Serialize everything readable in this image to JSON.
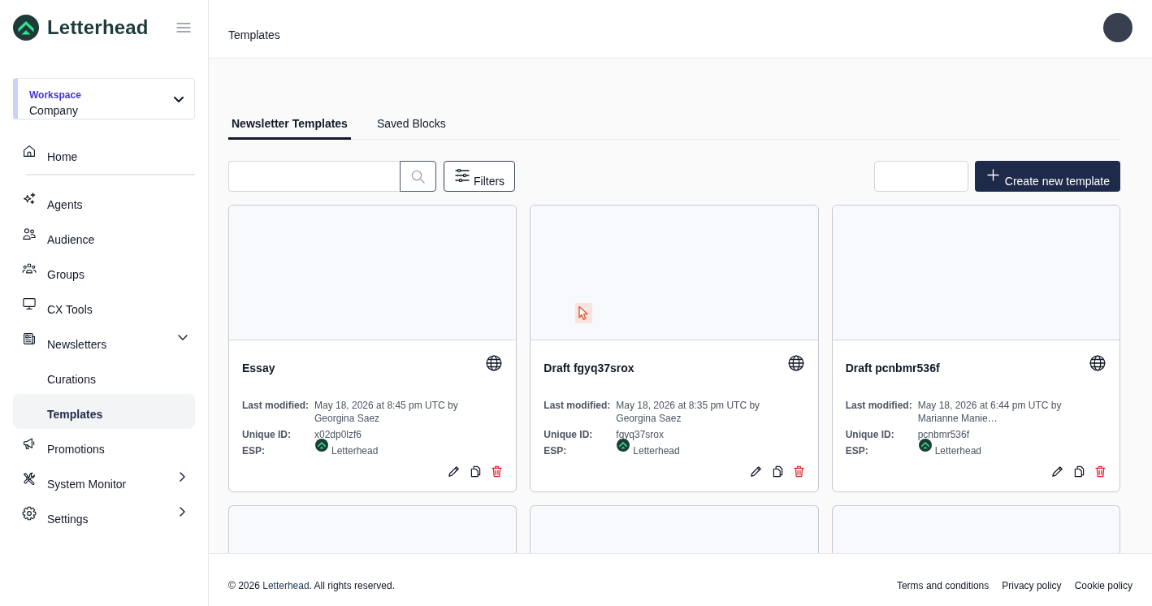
{
  "brand": {
    "name": "Letterhead"
  },
  "workspace": {
    "label": "Workspace",
    "value": "Company"
  },
  "nav": {
    "groups": [
      {
        "items": [
          {
            "label": "Home",
            "selected": false
          }
        ]
      },
      {
        "items": [
          {
            "label": "Agents",
            "selected": false
          },
          {
            "label": "Audience",
            "selected": false
          },
          {
            "label": "Groups",
            "selected": false
          },
          {
            "label": "CX Tools",
            "selected": false
          },
          {
            "label": "Newsletters",
            "selected": false,
            "expanded": true,
            "children": [
              {
                "label": "Curations",
                "selected": false
              },
              {
                "label": "Templates",
                "selected": true
              }
            ]
          },
          {
            "label": "Promotions",
            "selected": false
          },
          {
            "label": "System Monitor",
            "selected": false,
            "expanded": false
          },
          {
            "label": "Settings",
            "selected": false,
            "expanded": false
          }
        ]
      }
    ]
  },
  "header": {
    "title": "Templates"
  },
  "tabs": [
    {
      "label": "Newsletter Templates",
      "selected": true
    },
    {
      "label": "Saved Blocks",
      "selected": false
    }
  ],
  "toolbar": {
    "filters": "Filters",
    "create": "Create new template"
  },
  "cards": [
    {
      "title": "Essay",
      "public": true,
      "thumbnail": false,
      "fields": [
        {
          "kind": "text",
          "label": "Last modified:",
          "value": "May 18, 2026 at 8:45 pm UTC by Georgina Saez"
        },
        {
          "kind": "text",
          "label": "Unique ID:",
          "value": "x02dp0lzf6"
        },
        {
          "kind": "esp",
          "label": "ESP:",
          "value": "Letterhead"
        }
      ]
    },
    {
      "title": "Draft fgyq37srox",
      "public": true,
      "thumbnail": true,
      "fields": [
        {
          "kind": "text",
          "label": "Last modified:",
          "value": "May 18, 2026 at 8:35 pm UTC by Georgina Saez"
        },
        {
          "kind": "text",
          "label": "Unique ID:",
          "value": "fgyq37srox"
        },
        {
          "kind": "esp",
          "label": "ESP:",
          "value": "Letterhead"
        }
      ]
    },
    {
      "title": "Draft pcnbmr536f",
      "public": true,
      "thumbnail": false,
      "fields": [
        {
          "kind": "text",
          "label": "Last modified:",
          "value": "May 18, 2026 at 6:44 pm UTC by Marianne Manie…"
        },
        {
          "kind": "text",
          "label": "Unique ID:",
          "value": "pcnbmr536f"
        },
        {
          "kind": "esp",
          "label": "ESP:",
          "value": "Letterhead"
        }
      ]
    }
  ],
  "partial_cards": [
    {
      "thumbnail": false
    },
    {
      "thumbnail": false
    },
    {
      "thumbnail": false
    }
  ],
  "footer": {
    "copyright": {
      "before": "© 2026 ",
      "link": "Letterhead",
      "after": ". All rights reserved."
    },
    "links": [
      "Terms and conditions",
      "Privacy policy",
      "Cookie policy"
    ]
  }
}
